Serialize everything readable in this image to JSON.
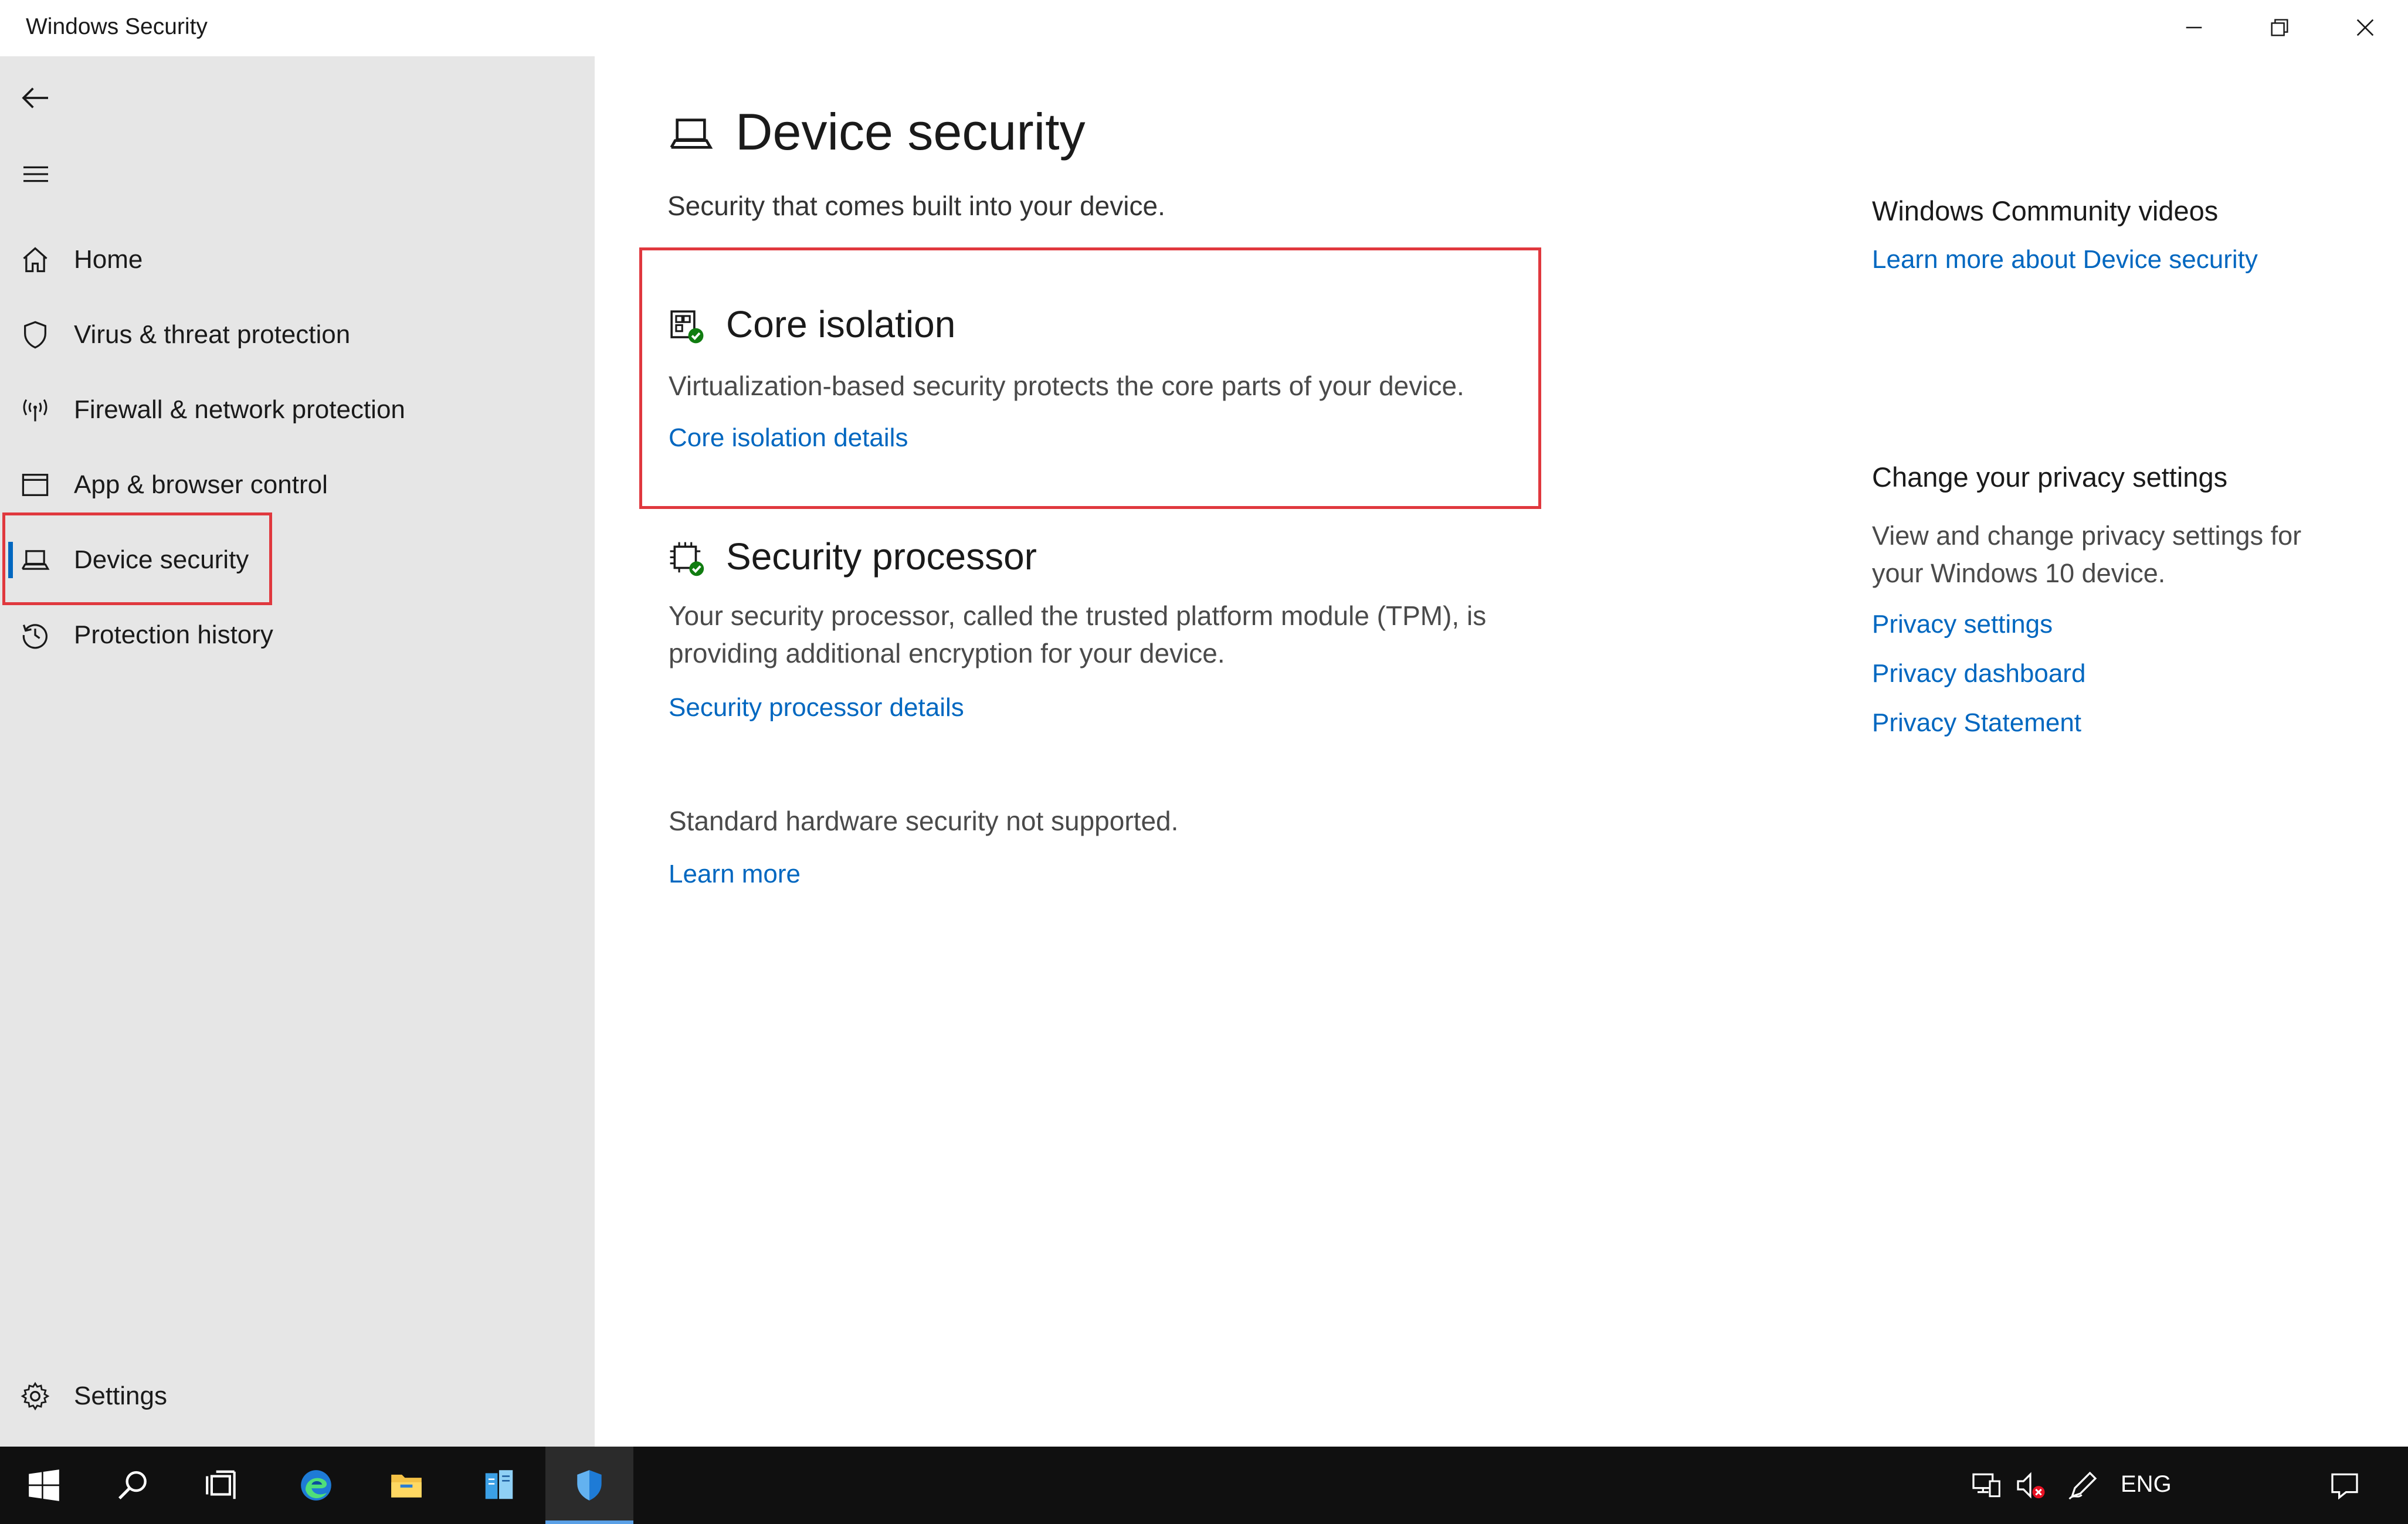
{
  "window": {
    "title": "Windows Security"
  },
  "sidebar": {
    "items": [
      {
        "label": "Home",
        "icon": "home-icon"
      },
      {
        "label": "Virus & threat protection",
        "icon": "shield-icon"
      },
      {
        "label": "Firewall & network protection",
        "icon": "antenna-icon"
      },
      {
        "label": "App & browser control",
        "icon": "browser-window-icon"
      },
      {
        "label": "Device security",
        "icon": "laptop-icon",
        "selected": true
      },
      {
        "label": "Protection history",
        "icon": "history-icon"
      }
    ],
    "settings_label": "Settings"
  },
  "main": {
    "title": "Device security",
    "subtitle": "Security that comes built into your device.",
    "core_isolation": {
      "title": "Core isolation",
      "description": "Virtualization-based security protects the core parts of your device.",
      "link": "Core isolation details"
    },
    "security_processor": {
      "title": "Security processor",
      "description": "Your security processor, called the trusted platform module (TPM), is providing additional encryption for your device.",
      "link": "Security processor details"
    },
    "hardware": {
      "text": "Standard hardware security not supported.",
      "link": "Learn more"
    }
  },
  "right_panel": {
    "community": {
      "heading": "Windows Community videos",
      "link": "Learn more about Device security"
    },
    "privacy": {
      "heading": "Change your privacy settings",
      "text": "View and change privacy settings for your Windows 10 device.",
      "links": [
        "Privacy settings",
        "Privacy dashboard",
        "Privacy Statement"
      ]
    }
  },
  "taskbar": {
    "language": "ENG",
    "apps": [
      "start-icon",
      "search-icon",
      "task-view-icon",
      "edge-icon",
      "file-explorer-icon",
      "server-manager-icon",
      "windows-security-icon"
    ]
  },
  "colors": {
    "accent": "#0067c0",
    "highlight": "#e0383e",
    "sidebar_bg": "#e6e6e6",
    "taskbar_bg": "#101010"
  }
}
